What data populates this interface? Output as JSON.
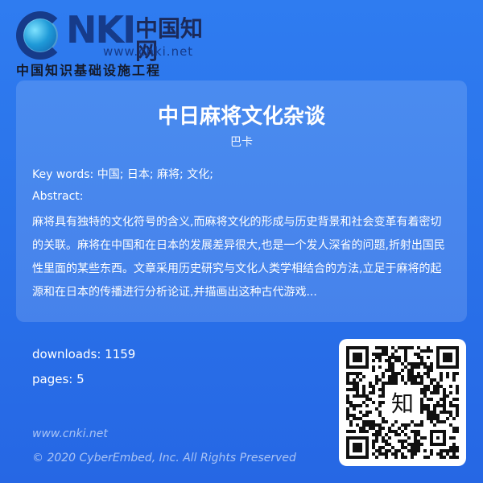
{
  "brand": {
    "logo_text": "CNKI",
    "logo_cn": "中国知网",
    "logo_url": "www.cnki.net",
    "subtitle": "中国知识基础设施工程"
  },
  "article": {
    "title": "中日麻将文化杂谈",
    "author": "巴卡",
    "keywords_label": "Key words:",
    "keywords": "中国; 日本; 麻将; 文化;",
    "abstract_label": "Abstract:",
    "abstract": "麻将具有独特的文化符号的含义,而麻将文化的形成与历史背景和社会变革有着密切的关联。麻将在中国和在日本的发展差异很大,也是一个发人深省的问题,折射出国民性里面的某些东西。文章采用历史研究与文化人类学相结合的方法,立足于麻将的起源和在日本的传播进行分析论证,并描画出这种古代游戏..."
  },
  "stats": {
    "downloads": "downloads: 1159",
    "pages": "pages: 5"
  },
  "qr": {
    "center_text": "知",
    "icon": "qr-code-icon"
  },
  "footer": {
    "url": "www.cnki.net",
    "copyright": "© 2020 CyberEmbed, Inc. All Rights Preserved"
  },
  "colors": {
    "background": "#2a73ea",
    "card": "rgba(255,255,255,0.14)",
    "text": "#ffffff"
  }
}
